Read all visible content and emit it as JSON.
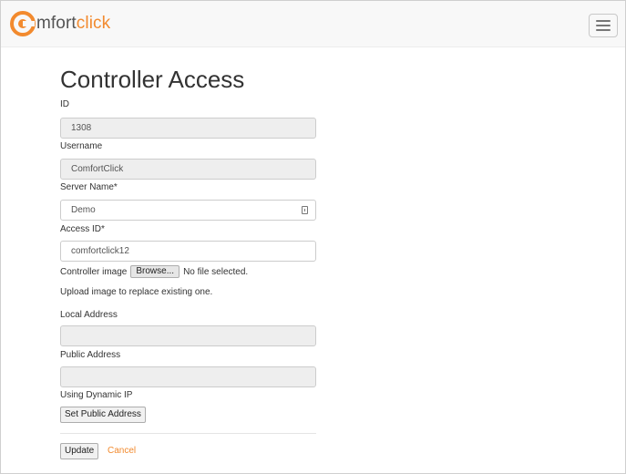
{
  "brand": {
    "logo_letter": "c",
    "name_primary": "mfort",
    "name_accent": "click",
    "accent_color": "#f28a2e"
  },
  "nav": {
    "menu_icon": "hamburger-menu-icon"
  },
  "page": {
    "title": "Controller Access"
  },
  "form": {
    "id": {
      "label": "ID",
      "value": "1308"
    },
    "username": {
      "label": "Username",
      "value": "ComfortClick"
    },
    "server_name": {
      "label": "Server Name*",
      "value": "Demo",
      "icon": "contact-card-icon"
    },
    "access_id": {
      "label": "Access ID*",
      "value": "comfortclick12"
    },
    "controller_image": {
      "label": "Controller image",
      "browse_label": "Browse...",
      "status": "No file selected.",
      "help": "Upload image to replace existing one."
    },
    "local_address": {
      "label": "Local Address",
      "value": ""
    },
    "public_address": {
      "label": "Public Address",
      "value": ""
    },
    "dynamic_ip": {
      "label": "Using Dynamic IP"
    },
    "set_public_address_label": "Set Public Address",
    "update_label": "Update",
    "cancel_label": "Cancel"
  },
  "colors": {
    "accent": "#f28a2e",
    "readonly_bg": "#eeeeee",
    "navbar_bg": "#f8f8f8"
  }
}
